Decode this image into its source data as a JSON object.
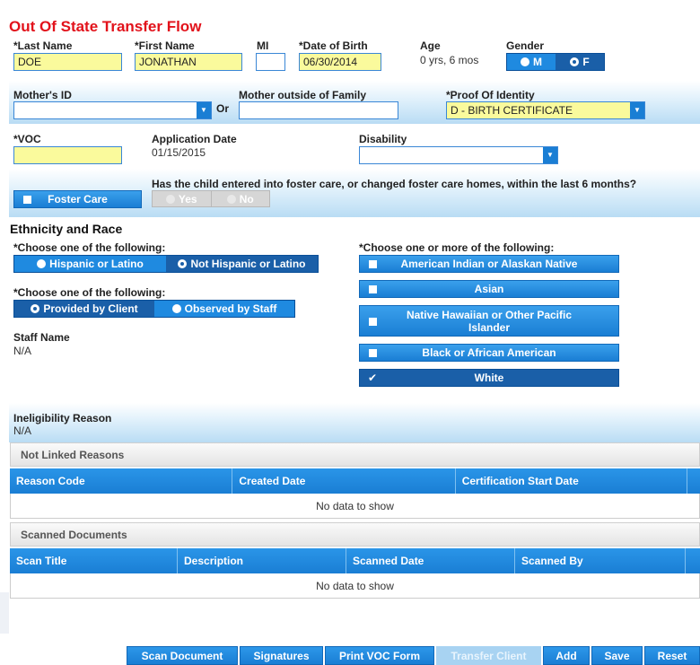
{
  "page_title": "Out Of State Transfer Flow",
  "demographics": {
    "last_name_label": "*Last Name",
    "last_name_value": "DOE",
    "first_name_label": "*First Name",
    "first_name_value": "JONATHAN",
    "mi_label": "MI",
    "mi_value": "",
    "dob_label": "*Date of Birth",
    "dob_value": "06/30/2014",
    "age_label": "Age",
    "age_value": "0 yrs, 6 mos",
    "gender_label": "Gender",
    "gender_options": [
      "M",
      "F"
    ],
    "gender_selected": "F"
  },
  "identity": {
    "mothers_id_label": "Mother's ID",
    "mothers_id_value": "",
    "or_text": "Or",
    "mother_outside_label": "Mother outside of Family",
    "mother_outside_value": "",
    "proof_label": "*Proof Of Identity",
    "proof_value": "D - BIRTH CERTIFICATE"
  },
  "voc": {
    "voc_label": "*VOC",
    "voc_value": "",
    "app_date_label": "Application Date",
    "app_date_value": "01/15/2015",
    "disability_label": "Disability",
    "disability_value": ""
  },
  "foster": {
    "button_label": "Foster Care",
    "question": "Has the child entered into foster care, or changed foster care homes, within the last 6 months?",
    "yes_label": "Yes",
    "no_label": "No"
  },
  "ethnicity": {
    "heading": "Ethnicity and Race",
    "ethnicity_prompt": "*Choose one of the following:",
    "ethnicity_options": [
      "Hispanic or Latino",
      "Not Hispanic or Latino"
    ],
    "ethnicity_selected": "Not Hispanic or Latino",
    "source_prompt": "*Choose one of the following:",
    "source_options": [
      "Provided by Client",
      "Observed by Staff"
    ],
    "source_selected": "Provided by Client",
    "staff_name_label": "Staff Name",
    "staff_name_value": "N/A",
    "race_prompt": "*Choose one or more of the following:",
    "race_options": [
      {
        "label": "American Indian or Alaskan Native",
        "checked": false
      },
      {
        "label": "Asian",
        "checked": false
      },
      {
        "label": "Native Hawaiian or Other Pacific Islander",
        "checked": false
      },
      {
        "label": "Black or African American",
        "checked": false
      },
      {
        "label": "White",
        "checked": true
      }
    ]
  },
  "ineligibility": {
    "label": "Ineligibility Reason",
    "value": "N/A"
  },
  "not_linked": {
    "title": "Not Linked Reasons",
    "columns": [
      "Reason Code",
      "Created Date",
      "Certification Start Date"
    ],
    "empty_text": "No data to show"
  },
  "scanned": {
    "title": "Scanned Documents",
    "columns": [
      "Scan Title",
      "Description",
      "Scanned Date",
      "Scanned By"
    ],
    "empty_text": "No data to show"
  },
  "footer_buttons": {
    "scan": "Scan Document",
    "signatures": "Signatures",
    "print_voc": "Print VOC Form",
    "transfer": "Transfer Client",
    "add": "Add",
    "save": "Save",
    "reset": "Reset"
  },
  "colors": {
    "title": "#e2121b",
    "accent": "#1a7ed4",
    "selected": "#1a5fa8",
    "required_field": "#fafa9c"
  }
}
